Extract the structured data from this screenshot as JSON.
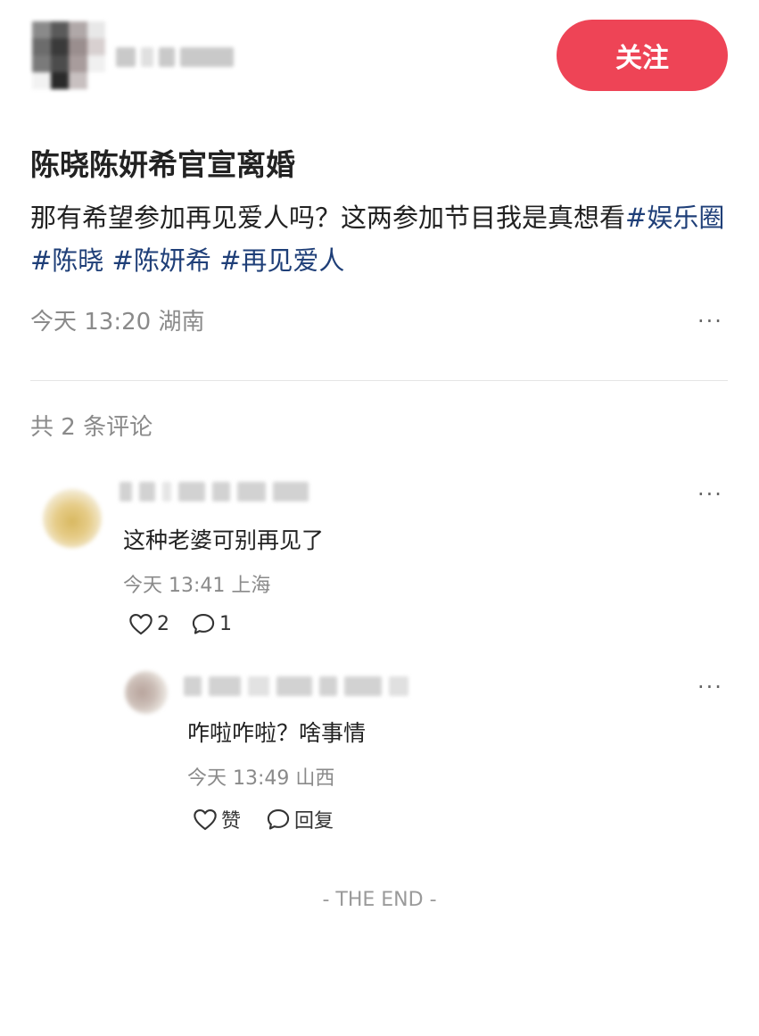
{
  "header": {
    "follow_label": "关注"
  },
  "post": {
    "title": "陈晓陈妍希官宣离婚",
    "body_text": "那有希望参加再见爱人吗？这两参加节目我是真想看",
    "tags": [
      "#娱乐圈",
      "#陈晓",
      "#陈妍希",
      "#再见爱人"
    ],
    "time": "今天 13:20",
    "location": "湖南",
    "more_label": "···"
  },
  "comments_section": {
    "count_label": "共 2 条评论"
  },
  "comments": [
    {
      "text": "这种老婆可别再见了",
      "time": "今天 13:41",
      "location": "上海",
      "likes": "2",
      "replies": "1",
      "more_label": "···"
    },
    {
      "text": "咋啦咋啦？啥事情",
      "time": "今天 13:49",
      "location": "山西",
      "like_label": "赞",
      "reply_label": "回复",
      "more_label": "···"
    }
  ],
  "footer": {
    "end_label": "- THE END -"
  },
  "colors": {
    "follow_button": "#ee4456",
    "tag": "#1f3f78",
    "meta_text": "#8a8a8a"
  }
}
